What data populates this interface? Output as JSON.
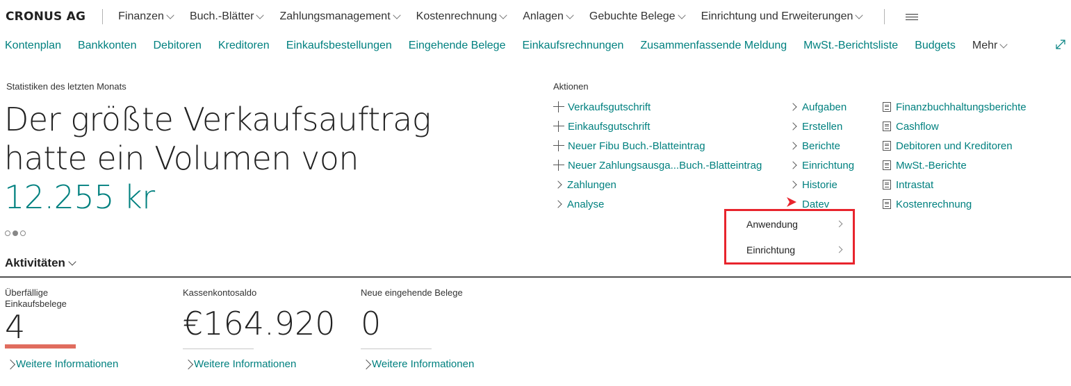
{
  "header": {
    "brand": "CRONUS AG",
    "menu": [
      "Finanzen",
      "Buch.-Blätter",
      "Zahlungsmanagement",
      "Kostenrechnung",
      "Anlagen",
      "Gebuchte Belege",
      "Einrichtung und Erweiterungen"
    ]
  },
  "subnav": {
    "items": [
      "Kontenplan",
      "Bankkonten",
      "Debitoren",
      "Kreditoren",
      "Einkaufsbestellungen",
      "Eingehende Belege",
      "Einkaufsrechnungen",
      "Zusammenfassende Meldung",
      "MwSt.-Berichtsliste",
      "Budgets"
    ],
    "more": "Mehr"
  },
  "headline": {
    "label": "Statistiken des letzten Monats",
    "text": "Der größte Verkaufsauftrag hatte ein Volumen von",
    "value": "12.255 kr"
  },
  "actions": {
    "label": "Aktionen",
    "col1": [
      {
        "icon": "plus-icon",
        "label": "Verkaufsgutschrift"
      },
      {
        "icon": "plus-icon",
        "label": "Einkaufsgutschrift"
      },
      {
        "icon": "plus-icon",
        "label": "Neuer Fibu Buch.-Blatteintrag"
      },
      {
        "icon": "plus-icon",
        "label": "Neuer Zahlungsausga...Buch.-Blatteintrag"
      },
      {
        "icon": "chevron-right-icon",
        "label": "Zahlungen"
      },
      {
        "icon": "chevron-right-icon",
        "label": "Analyse"
      }
    ],
    "col2": [
      "Aufgaben",
      "Erstellen",
      "Berichte",
      "Einrichtung",
      "Historie",
      "Datev"
    ],
    "col3": [
      "Finanzbuchhaltungsberichte",
      "Cashflow",
      "Debitoren und Kreditoren",
      "MwSt.-Berichte",
      "Intrastat",
      "Kostenrechnung"
    ]
  },
  "popup": {
    "items": [
      "Anwendung",
      "Einrichtung"
    ],
    "highlight_color": "#e8242d"
  },
  "activities": {
    "title": "Aktivitäten",
    "tiles": [
      {
        "label": "Überfällige Einkaufsbelege",
        "value": "4",
        "link": "Weitere Informationen",
        "bar_color": "#e06c5e"
      },
      {
        "label": "Kassenkontosaldo",
        "value": "€164.920",
        "link": "Weitere Informationen"
      },
      {
        "label": "Neue eingehende Belege",
        "value": "0",
        "link": "Weitere Informationen"
      }
    ]
  },
  "colors": {
    "accent": "#00807f",
    "text": "#212121"
  }
}
